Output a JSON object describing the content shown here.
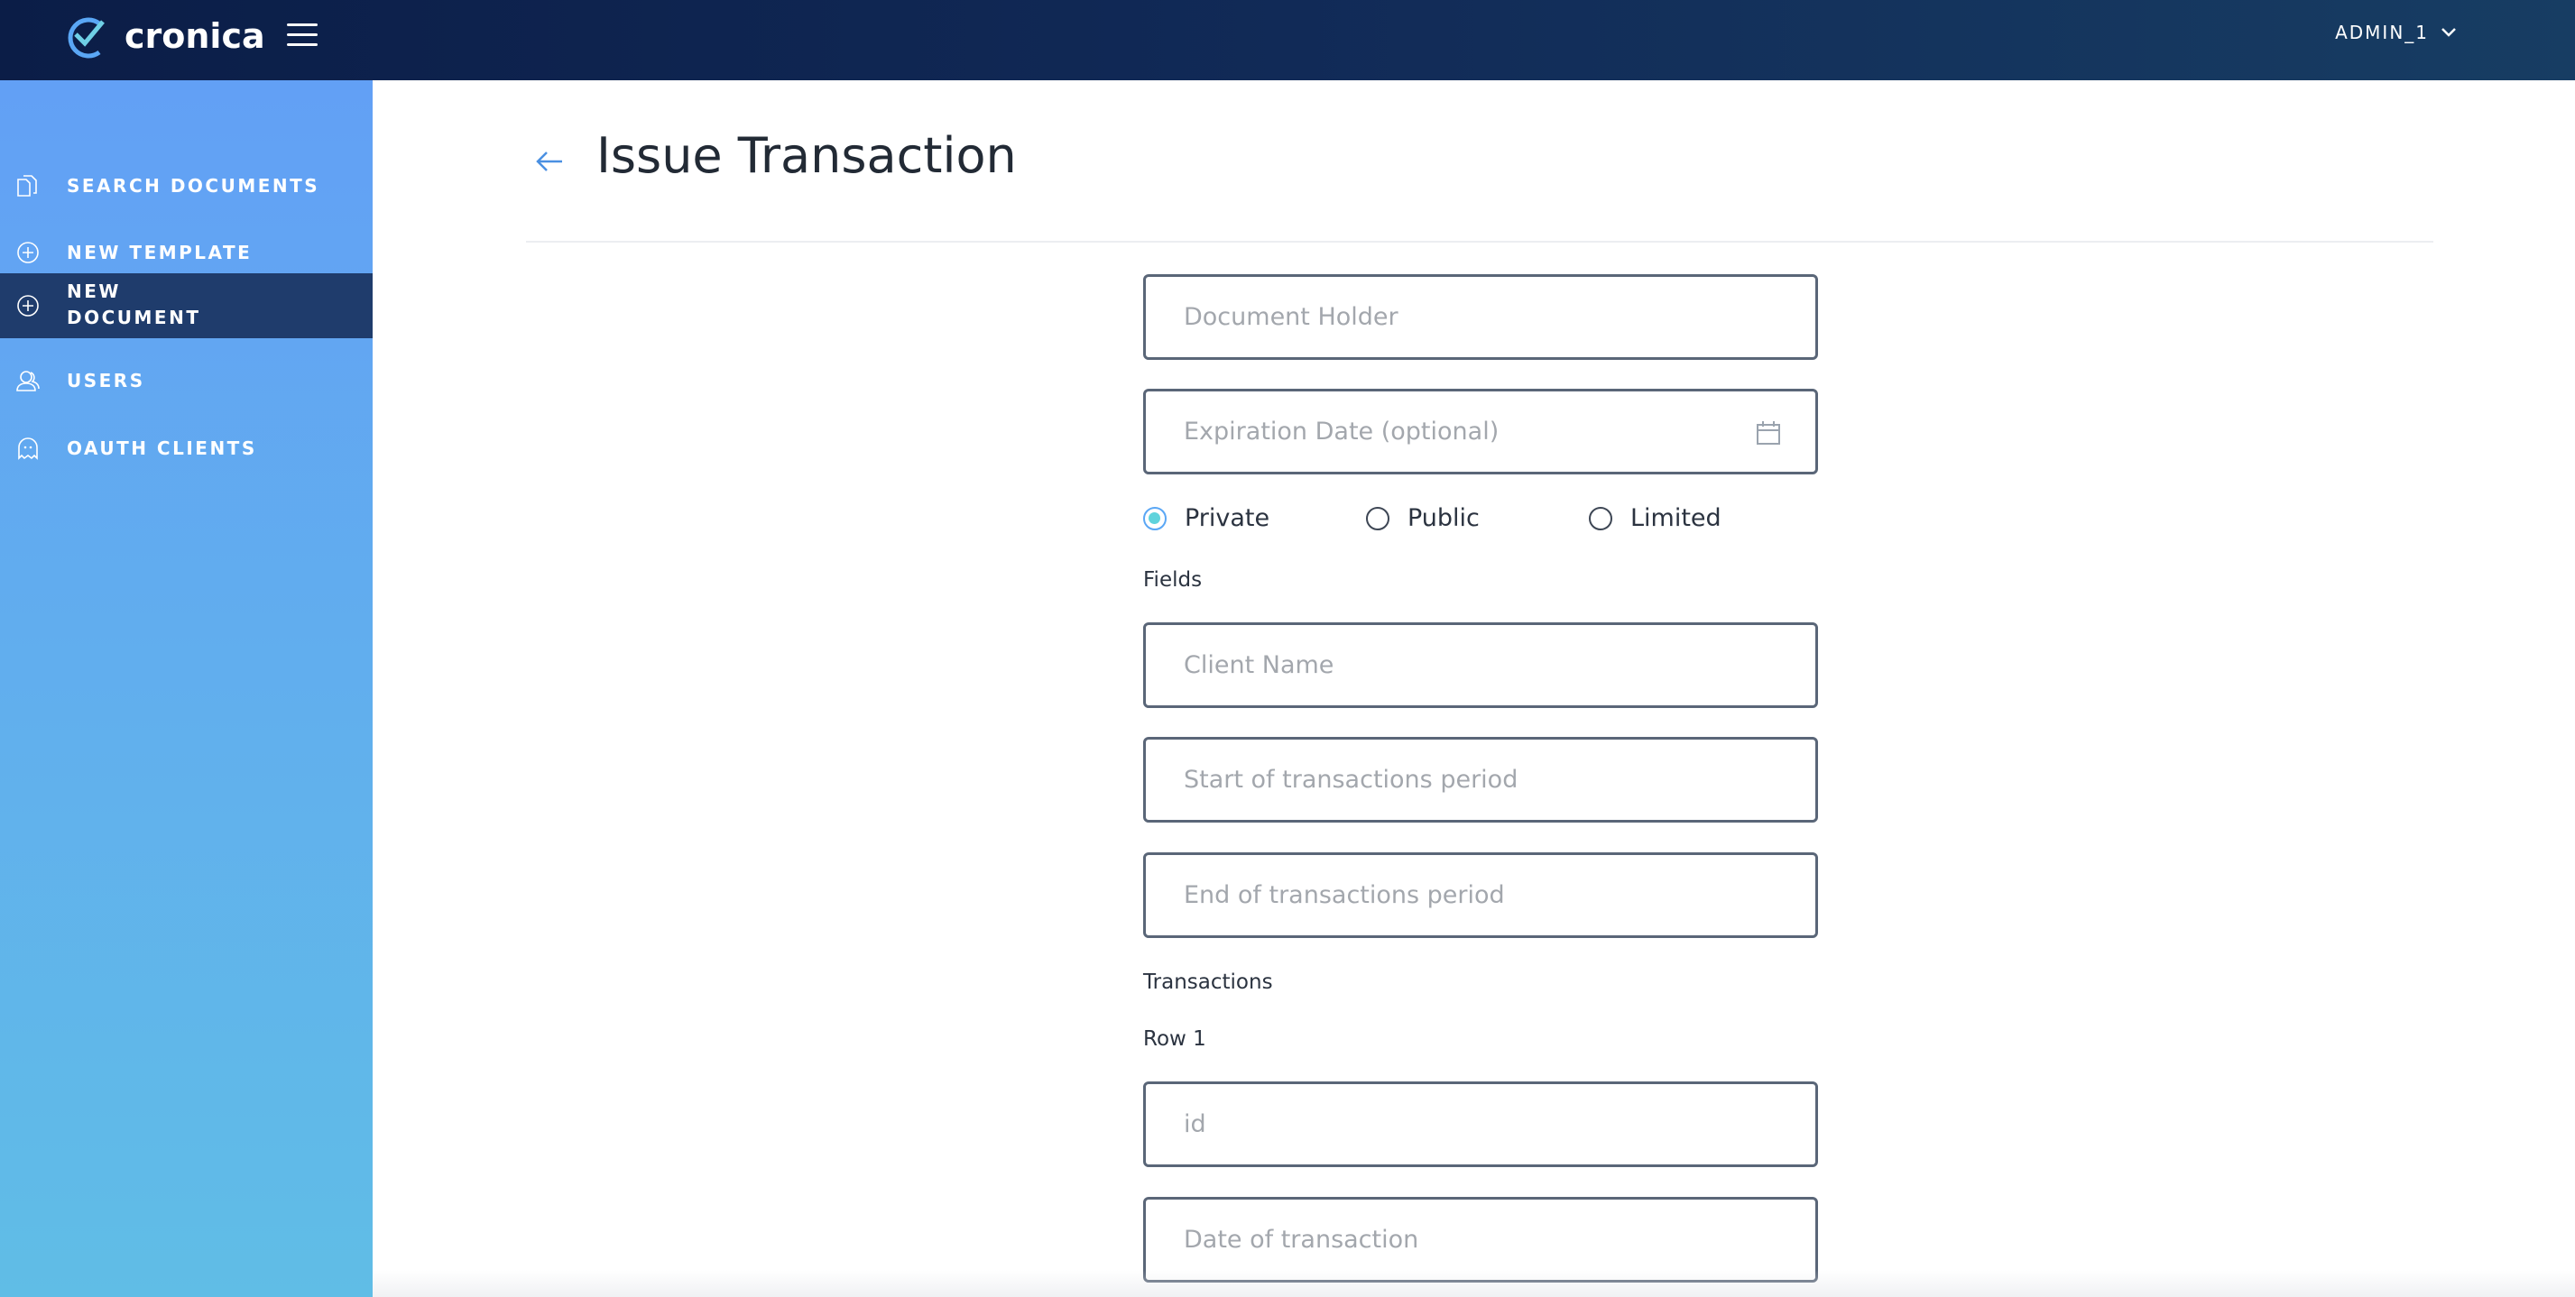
{
  "app": {
    "name": "cronica",
    "user": "ADMIN_1"
  },
  "sidebar": {
    "items": [
      {
        "label": "SEARCH DOCUMENTS",
        "icon": "documents-icon"
      },
      {
        "label": "NEW TEMPLATE",
        "icon": "plus-circle-icon"
      },
      {
        "label_line1": "NEW",
        "label_line2": "DOCUMENT",
        "icon": "plus-circle-icon",
        "active": true
      },
      {
        "label": "USERS",
        "icon": "users-icon"
      },
      {
        "label": "OAUTH CLIENTS",
        "icon": "ghost-icon"
      }
    ]
  },
  "page": {
    "title": "Issue Transaction"
  },
  "form": {
    "document_holder": {
      "placeholder": "Document Holder",
      "value": ""
    },
    "expiration_date": {
      "placeholder": "Expiration Date (optional)",
      "value": ""
    },
    "visibility": {
      "options": [
        "Private",
        "Public",
        "Limited"
      ],
      "selected": "Private"
    },
    "fields_label": "Fields",
    "client_name": {
      "placeholder": "Client Name",
      "value": ""
    },
    "start_period": {
      "placeholder": "Start of transactions period",
      "value": ""
    },
    "end_period": {
      "placeholder": "End of transactions period",
      "value": ""
    },
    "transactions_label": "Transactions",
    "row_label": "Row 1",
    "row_id": {
      "placeholder": "id",
      "value": ""
    },
    "row_date": {
      "placeholder": "Date of transaction",
      "value": ""
    }
  },
  "colors": {
    "header": "#0b1d47",
    "sidebar_top": "#62a0f5",
    "sidebar_bottom": "#60bde6",
    "active_item": "#1f3c6c",
    "accent": "#5aa7f5"
  }
}
